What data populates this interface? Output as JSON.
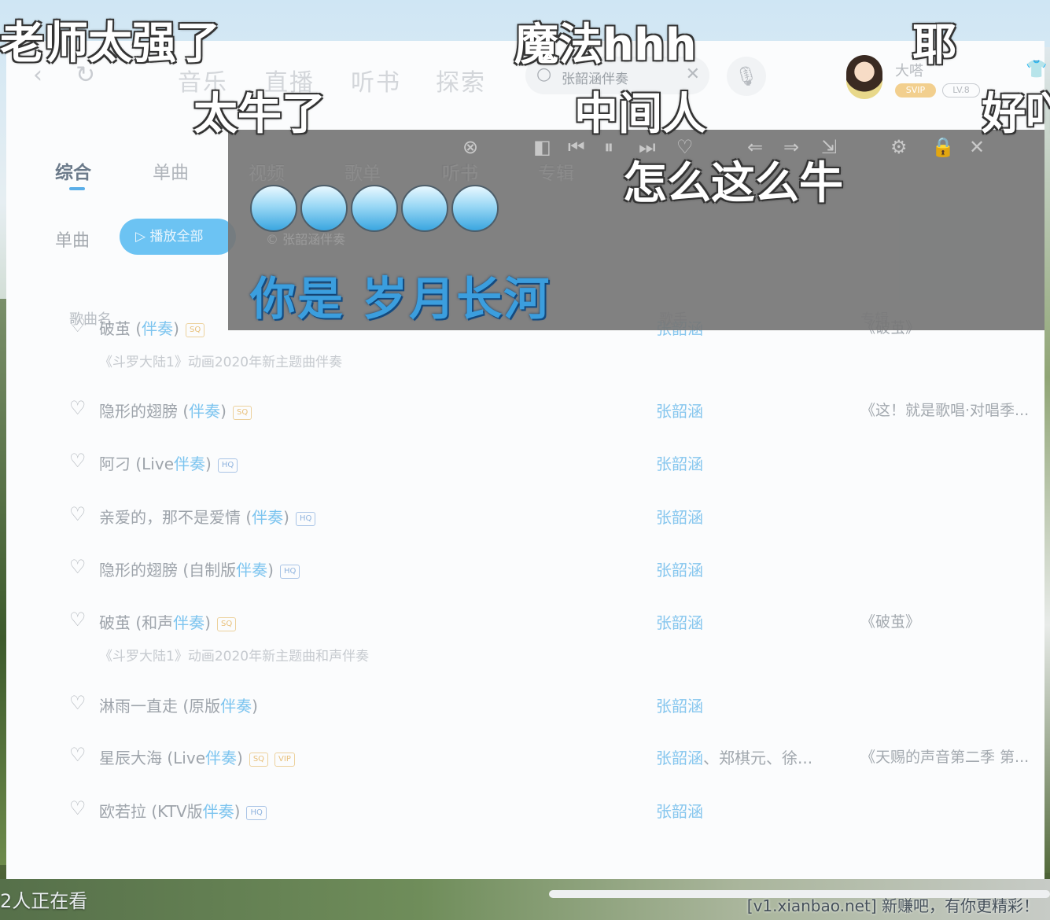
{
  "topbar": {
    "back_icon": "‹",
    "refresh_icon": "↻",
    "tabs": [
      "音乐",
      "直播",
      "听书",
      "探索"
    ],
    "search_icon": "search-icon",
    "search_value": "张韶涵伴奏",
    "clear_icon": "✕",
    "mic_icon": "🎙",
    "user_name": "大嗒",
    "svip_badge": "SVIP",
    "level_badge": "LV.8",
    "skin_icon": "👕"
  },
  "subtabs": [
    "综合",
    "单曲",
    "视频",
    "歌单",
    "听书",
    "专辑"
  ],
  "section": {
    "label": "单曲",
    "play_all": "▷ 播放全部"
  },
  "columns": {
    "name": "歌曲名",
    "singer": "歌手",
    "album": "专辑"
  },
  "songs": [
    {
      "title": "破茧 (",
      "acc": "伴奏",
      "tail": ")",
      "quality": "SQ",
      "sub": "《斗罗大陆1》动画2020年新主题曲伴奏",
      "singer": "张韶涵",
      "singer_more": "",
      "album": "《破茧》"
    },
    {
      "title": "隐形的翅膀 (",
      "acc": "伴奏",
      "tail": ")",
      "quality": "SQ",
      "sub": "",
      "singer": "张韶涵",
      "singer_more": "",
      "album": "《这！就是歌唱·对唱季..."
    },
    {
      "title": "阿刁 (Live",
      "acc": "伴奏",
      "tail": ")",
      "quality": "HQ",
      "sub": "",
      "singer": "张韶涵",
      "singer_more": "",
      "album": ""
    },
    {
      "title": "亲爱的，那不是爱情 (",
      "acc": "伴奏",
      "tail": ")",
      "quality": "HQ",
      "sub": "",
      "singer": "张韶涵",
      "singer_more": "",
      "album": ""
    },
    {
      "title": "隐形的翅膀 (自制版",
      "acc": "伴奏",
      "tail": ")",
      "quality": "HQ",
      "sub": "",
      "singer": "张韶涵",
      "singer_more": "",
      "album": ""
    },
    {
      "title": "破茧 (和声",
      "acc": "伴奏",
      "tail": ")",
      "quality": "SQ",
      "sub": "《斗罗大陆1》动画2020年新主题曲和声伴奏",
      "singer": "张韶涵",
      "singer_more": "",
      "album": "《破茧》"
    },
    {
      "title": "淋雨一直走 (原版",
      "acc": "伴奏",
      "tail": ")",
      "quality": "",
      "sub": "",
      "singer": "张韶涵",
      "singer_more": "",
      "album": ""
    },
    {
      "title": "星辰大海 (Live",
      "acc": "伴奏",
      "tail": ")",
      "quality": "SQ",
      "quality2": "VIP",
      "sub": "",
      "singer": "张韶涵",
      "singer_more": "、郑棋元、徐...",
      "album": "《天赐的声音第二季 第..."
    },
    {
      "title": "欧若拉 (KTV版",
      "acc": "伴奏",
      "tail": ")",
      "quality": "HQ",
      "sub": "",
      "singer": "张韶涵",
      "singer_more": "",
      "album": ""
    }
  ],
  "lyric_panel": {
    "controls": [
      "⊗",
      "◧",
      "⏮",
      "⏸",
      "⏭",
      "♡",
      "⇐",
      "⇒",
      "⇲",
      "⚙",
      "🔒",
      "✕"
    ],
    "small_text": "© 张韶涵伴奏",
    "lyric": "你是 岁月长河"
  },
  "danmaku": [
    "老师太强了",
    "太牛了",
    "魔法hhh",
    "中间人",
    "耶",
    "好吖",
    "怎么这么牛"
  ],
  "footer": {
    "viewers": "2人正在看",
    "watermark": "[v1.xianbao.net] 新赚吧，有你更精彩！"
  },
  "colors": {
    "accent": "#6cc3f3",
    "lyric_blue": "#3b9ede",
    "overlay": "#767676"
  }
}
